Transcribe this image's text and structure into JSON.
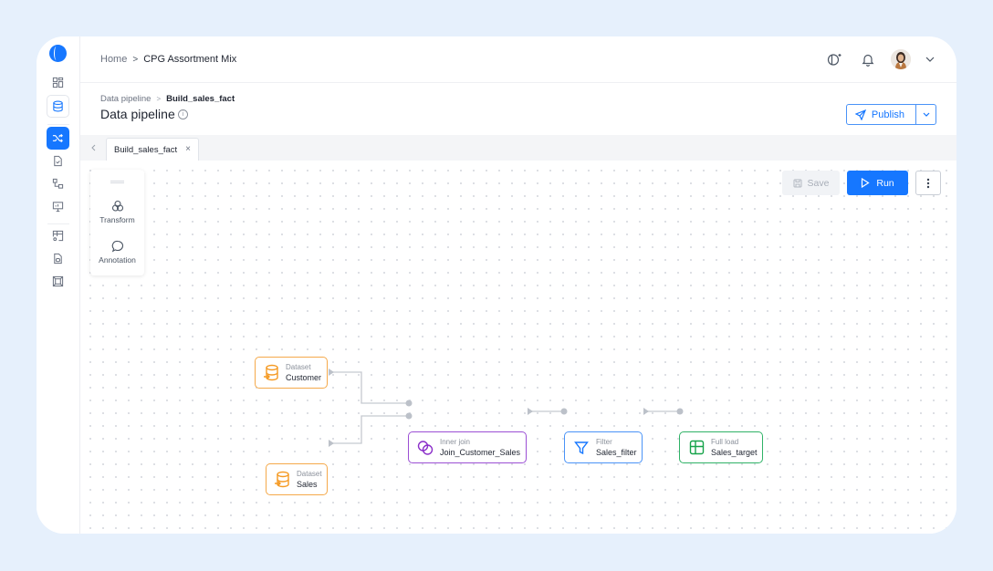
{
  "sidebar": {
    "logo": "app-logo",
    "items": [
      {
        "name": "dashboard",
        "icon": "grid-icon"
      },
      {
        "name": "datasets",
        "icon": "database-icon"
      },
      {
        "name": "data-pipeline",
        "icon": "shuffle-icon",
        "active": true
      },
      {
        "name": "reports",
        "icon": "document-check-icon"
      },
      {
        "name": "workflows",
        "icon": "workflow-icon"
      },
      {
        "name": "monitor",
        "icon": "monitor-icon"
      },
      {
        "name": "tables",
        "icon": "table-settings-icon"
      },
      {
        "name": "files",
        "icon": "file-icon"
      },
      {
        "name": "frames",
        "icon": "frame-icon"
      }
    ]
  },
  "topbar": {
    "breadcrumb": {
      "home": "Home",
      "separator": ">",
      "current": "CPG Assortment Mix"
    },
    "icons": [
      "theme-toggle-icon",
      "bell-icon",
      "avatar",
      "chevron-down-icon"
    ]
  },
  "page": {
    "breadcrumb": {
      "parent": "Data pipeline",
      "separator": ">",
      "current": "Build_sales_fact"
    },
    "title": "Data pipeline",
    "info": "i",
    "publish_label": "Publish"
  },
  "tabs": {
    "items": [
      {
        "label": "Build_sales_fact",
        "close": "×"
      }
    ]
  },
  "canvas": {
    "palette": [
      {
        "label": "Transform",
        "icon": "transform-icon"
      },
      {
        "label": "Annotation",
        "icon": "comment-icon"
      }
    ],
    "save_label": "Save",
    "run_label": "Run",
    "colors": {
      "dataset": "#f59a23",
      "join": "#8b2fc9",
      "filter": "#1677ff",
      "target": "#16a34a"
    },
    "nodes": [
      {
        "id": "customer",
        "type": "Dataset",
        "name": "Customer"
      },
      {
        "id": "sales",
        "type": "Dataset",
        "name": "Sales"
      },
      {
        "id": "join",
        "type": "Inner join",
        "name": "Join_Customer_Sales"
      },
      {
        "id": "filter",
        "type": "Filter",
        "name": "Sales_filter"
      },
      {
        "id": "target",
        "type": "Full load",
        "name": "Sales_target"
      }
    ]
  }
}
